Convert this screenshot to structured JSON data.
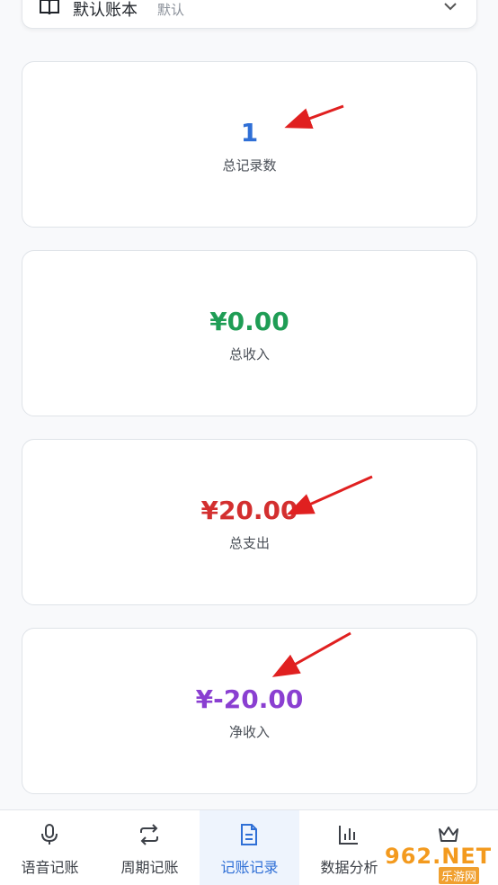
{
  "account": {
    "name": "默认账本",
    "tag": "默认"
  },
  "stats": [
    {
      "value": "1",
      "label": "总记录数",
      "color": "#2f6fd6"
    },
    {
      "value": "¥0.00",
      "label": "总收入",
      "color": "#1f9d55"
    },
    {
      "value": "¥20.00",
      "label": "总支出",
      "color": "#d32f2f"
    },
    {
      "value": "¥-20.00",
      "label": "净收入",
      "color": "#8a3fd1"
    }
  ],
  "nav": [
    {
      "label": "语音记账",
      "icon": "mic-icon"
    },
    {
      "label": "周期记账",
      "icon": "repeat-icon"
    },
    {
      "label": "记账记录",
      "icon": "document-icon",
      "active": true
    },
    {
      "label": "数据分析",
      "icon": "bar-chart-icon"
    },
    {
      "label": "",
      "icon": "crown-icon"
    }
  ],
  "watermark": {
    "top": "962.NET",
    "bottom": "乐游网"
  },
  "colors": {
    "accent": "#2f6fd6",
    "arrow": "#e02020"
  }
}
